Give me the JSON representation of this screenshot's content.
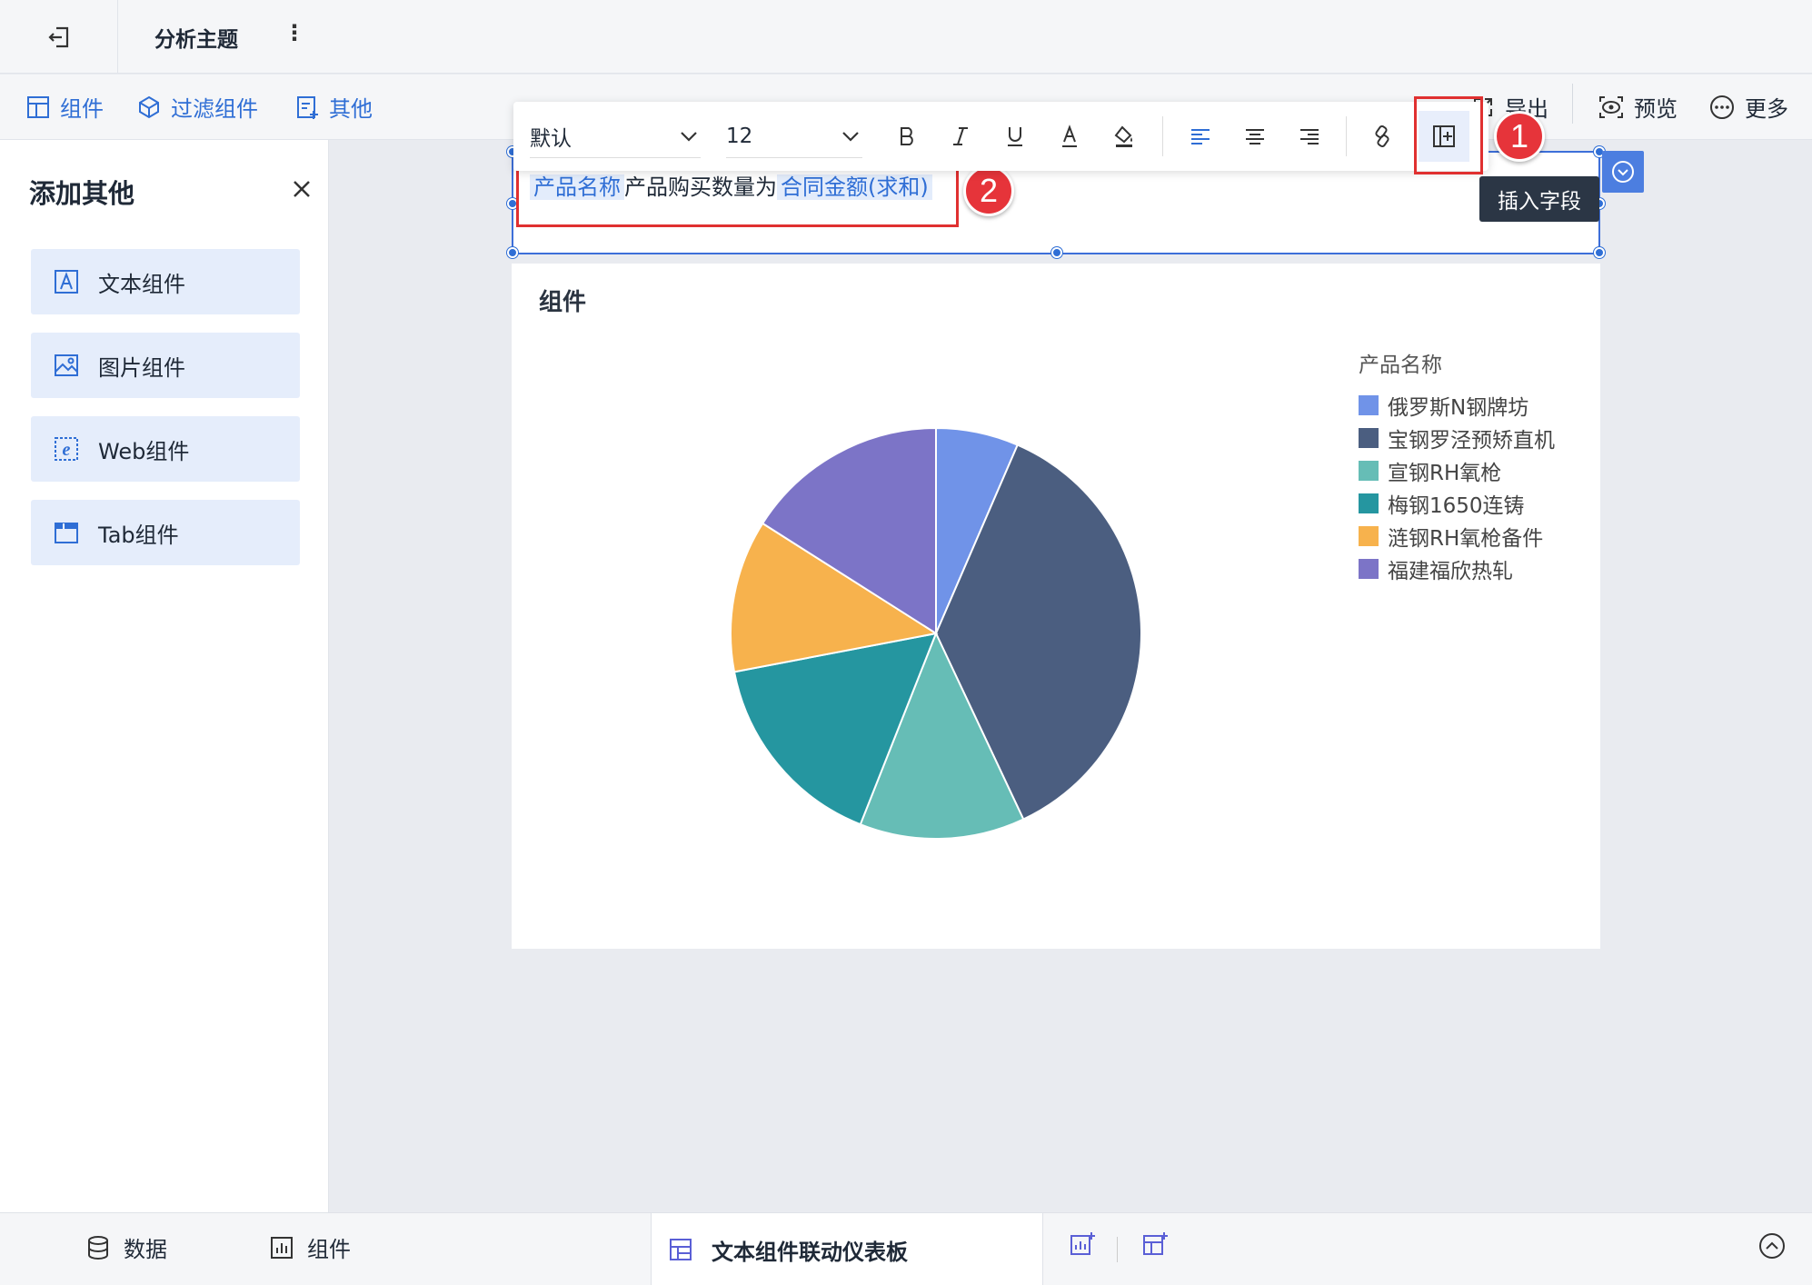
{
  "topbar": {
    "title": "分析主题",
    "kebab": "⋮"
  },
  "toolbar": {
    "left_items": [
      {
        "label": "组件",
        "icon": "add-component-icon"
      },
      {
        "label": "过滤组件",
        "icon": "filter-component-icon"
      },
      {
        "label": "其他",
        "icon": "other-component-icon"
      }
    ],
    "right_items": [
      {
        "label": "导出",
        "icon": "export-icon"
      },
      {
        "label": "预览",
        "icon": "preview-icon"
      },
      {
        "label": "更多",
        "icon": "more-icon"
      }
    ]
  },
  "panel": {
    "title": "添加其他",
    "items": [
      {
        "label": "文本组件",
        "icon": "text-component-icon"
      },
      {
        "label": "图片组件",
        "icon": "image-component-icon"
      },
      {
        "label": "Web组件",
        "icon": "web-component-icon"
      },
      {
        "label": "Tab组件",
        "icon": "tab-component-icon"
      }
    ]
  },
  "format_bar": {
    "font_family": "默认",
    "font_size": "12",
    "buttons": [
      "bold",
      "italic",
      "underline",
      "font-color",
      "fill-color",
      "align-left",
      "align-center",
      "align-right",
      "link",
      "insert-field"
    ]
  },
  "text_component": {
    "field1": "产品名称",
    "static_text": "产品购买数量为",
    "field2": "合同金额(求和)"
  },
  "tooltip": "插入字段",
  "badges": [
    "1",
    "2"
  ],
  "chart_card": {
    "title": "组件",
    "legend_title": "产品名称"
  },
  "chart_data": {
    "type": "pie",
    "title": "组件",
    "legend_title": "产品名称",
    "legend_position": "right",
    "slices": [
      {
        "name": "俄罗斯N钢牌坊",
        "value": 6.5,
        "color": "#7093e8"
      },
      {
        "name": "宝钢罗泾预矫直机",
        "value": 36.5,
        "color": "#4b5e80"
      },
      {
        "name": "宣钢RH氧枪",
        "value": 13.0,
        "color": "#66bdb6"
      },
      {
        "name": "梅钢1650连铸",
        "value": 16.0,
        "color": "#2596a0"
      },
      {
        "name": "涟钢RH氧枪备件",
        "value": 12.0,
        "color": "#f7b24d"
      },
      {
        "name": "福建福欣热轧",
        "value": 16.0,
        "color": "#7c74c7"
      }
    ]
  },
  "bottom": {
    "data_label": "数据",
    "component_label": "组件",
    "active_tab": "文本组件联动仪表板"
  }
}
